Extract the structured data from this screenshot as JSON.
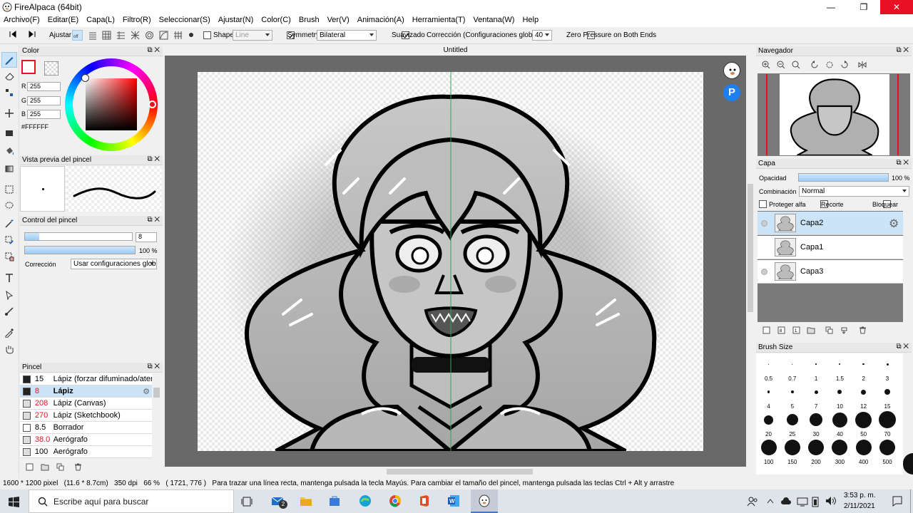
{
  "window": {
    "title": "FireAlpaca (64bit)",
    "min": "—",
    "max": "❐",
    "close": "✕"
  },
  "menu": [
    "Archivo(F)",
    "Editar(E)",
    "Capa(L)",
    "Filtro(R)",
    "Seleccionar(S)",
    "Ajustar(N)",
    "Color(C)",
    "Brush",
    "Ver(V)",
    "Animación(A)",
    "Herramienta(T)",
    "Ventana(W)",
    "Help"
  ],
  "toolbar": {
    "ajustar": "Ajustar",
    "shape_label": "Shape",
    "shape_value": "Line",
    "symmetry_label": "Symmetry",
    "symmetry_value": "Bilateral",
    "suavizado_label": "Suavizado",
    "correccion_label": "Corrección (Configuraciones globales)",
    "correccion_value": "40",
    "zero_pressure_label": "Zero Pressure on Both Ends",
    "symmetry_checked": true,
    "suavizado_checked": true,
    "shape_checked": false,
    "zero_pressure_checked": false
  },
  "color_panel": {
    "title": "Color",
    "r_label": "R",
    "r": "255",
    "g_label": "G",
    "g": "255",
    "b_label": "B",
    "b": "255",
    "hex": "#FFFFFF",
    "primary": "#FFFFFF",
    "outline_accent": "#e81123"
  },
  "brush_preview": {
    "title": "Vista previa del pincel"
  },
  "brush_control": {
    "title": "Control del pincel",
    "size": "8",
    "opacity": "100 %",
    "opacity_fraction": 1.0,
    "size_fraction": 0.13,
    "correccion_label": "Corrección",
    "correccion_value": "Usar configuraciones global"
  },
  "brush_list": {
    "title": "Pincel",
    "items": [
      {
        "size": "15",
        "name": "Lápiz (forzar difuminado/aten",
        "swatch": "#222222",
        "size_color": "#000000"
      },
      {
        "size": "8",
        "name": "Lápiz",
        "swatch": "#222222",
        "size_color": "#e81123"
      },
      {
        "size": "208",
        "name": "Lápiz (Canvas)",
        "swatch": "#dddddd",
        "size_color": "#e81123"
      },
      {
        "size": "270",
        "name": "Lápiz (Sketchbook)",
        "swatch": "#dddddd",
        "size_color": "#e81123"
      },
      {
        "size": "8.5",
        "name": "Borrador",
        "swatch": "#ffffff",
        "size_color": "#000000"
      },
      {
        "size": "38.0",
        "name": "Aerógrafo",
        "swatch": "#dddddd",
        "size_color": "#e81123"
      },
      {
        "size": "100",
        "name": "Aerógrafo",
        "swatch": "#dddddd",
        "size_color": "#000000"
      }
    ]
  },
  "canvas": {
    "tab_title": "Untitled"
  },
  "navigator": {
    "title": "Navegador"
  },
  "layer_panel": {
    "title": "Capa",
    "opacity_label": "Opacidad",
    "opacity_value": "100 %",
    "opacity_fraction": 1.0,
    "blend_label": "Combinación",
    "blend_value": "Normal",
    "protect_alpha": "Proteger alfa",
    "clip": "Recorte",
    "lock": "Bloquear",
    "layers": [
      {
        "name": "Capa2",
        "selected": true
      },
      {
        "name": "Capa1",
        "selected": false
      },
      {
        "name": "Capa3",
        "selected": false
      }
    ]
  },
  "brush_size": {
    "title": "Brush Size",
    "sizes": [
      "0.5",
      "0.7",
      "1",
      "1.5",
      "2",
      "3",
      "4",
      "5",
      "7",
      "10",
      "12",
      "15",
      "20",
      "25",
      "30",
      "40",
      "50",
      "70",
      "100",
      "150",
      "200",
      "300",
      "400",
      "500"
    ]
  },
  "status": {
    "dimensions": "1600 * 1200 pixel",
    "physical": "(11.6 * 8.7cm)",
    "dpi": "350 dpi",
    "zoom": "66 %",
    "coords": "( 1721, 776 )",
    "hint": "Para trazar una línea recta, mantenga pulsada la tecla Mayús. Para cambiar el tamaño del pincel, mantenga pulsada las teclas Ctrl + Alt y arrastre"
  },
  "taskbar": {
    "search_placeholder": "Escribe aquí para buscar",
    "mail_badge": "2",
    "time": "3:53 p. m.",
    "date": "2/11/2021"
  }
}
